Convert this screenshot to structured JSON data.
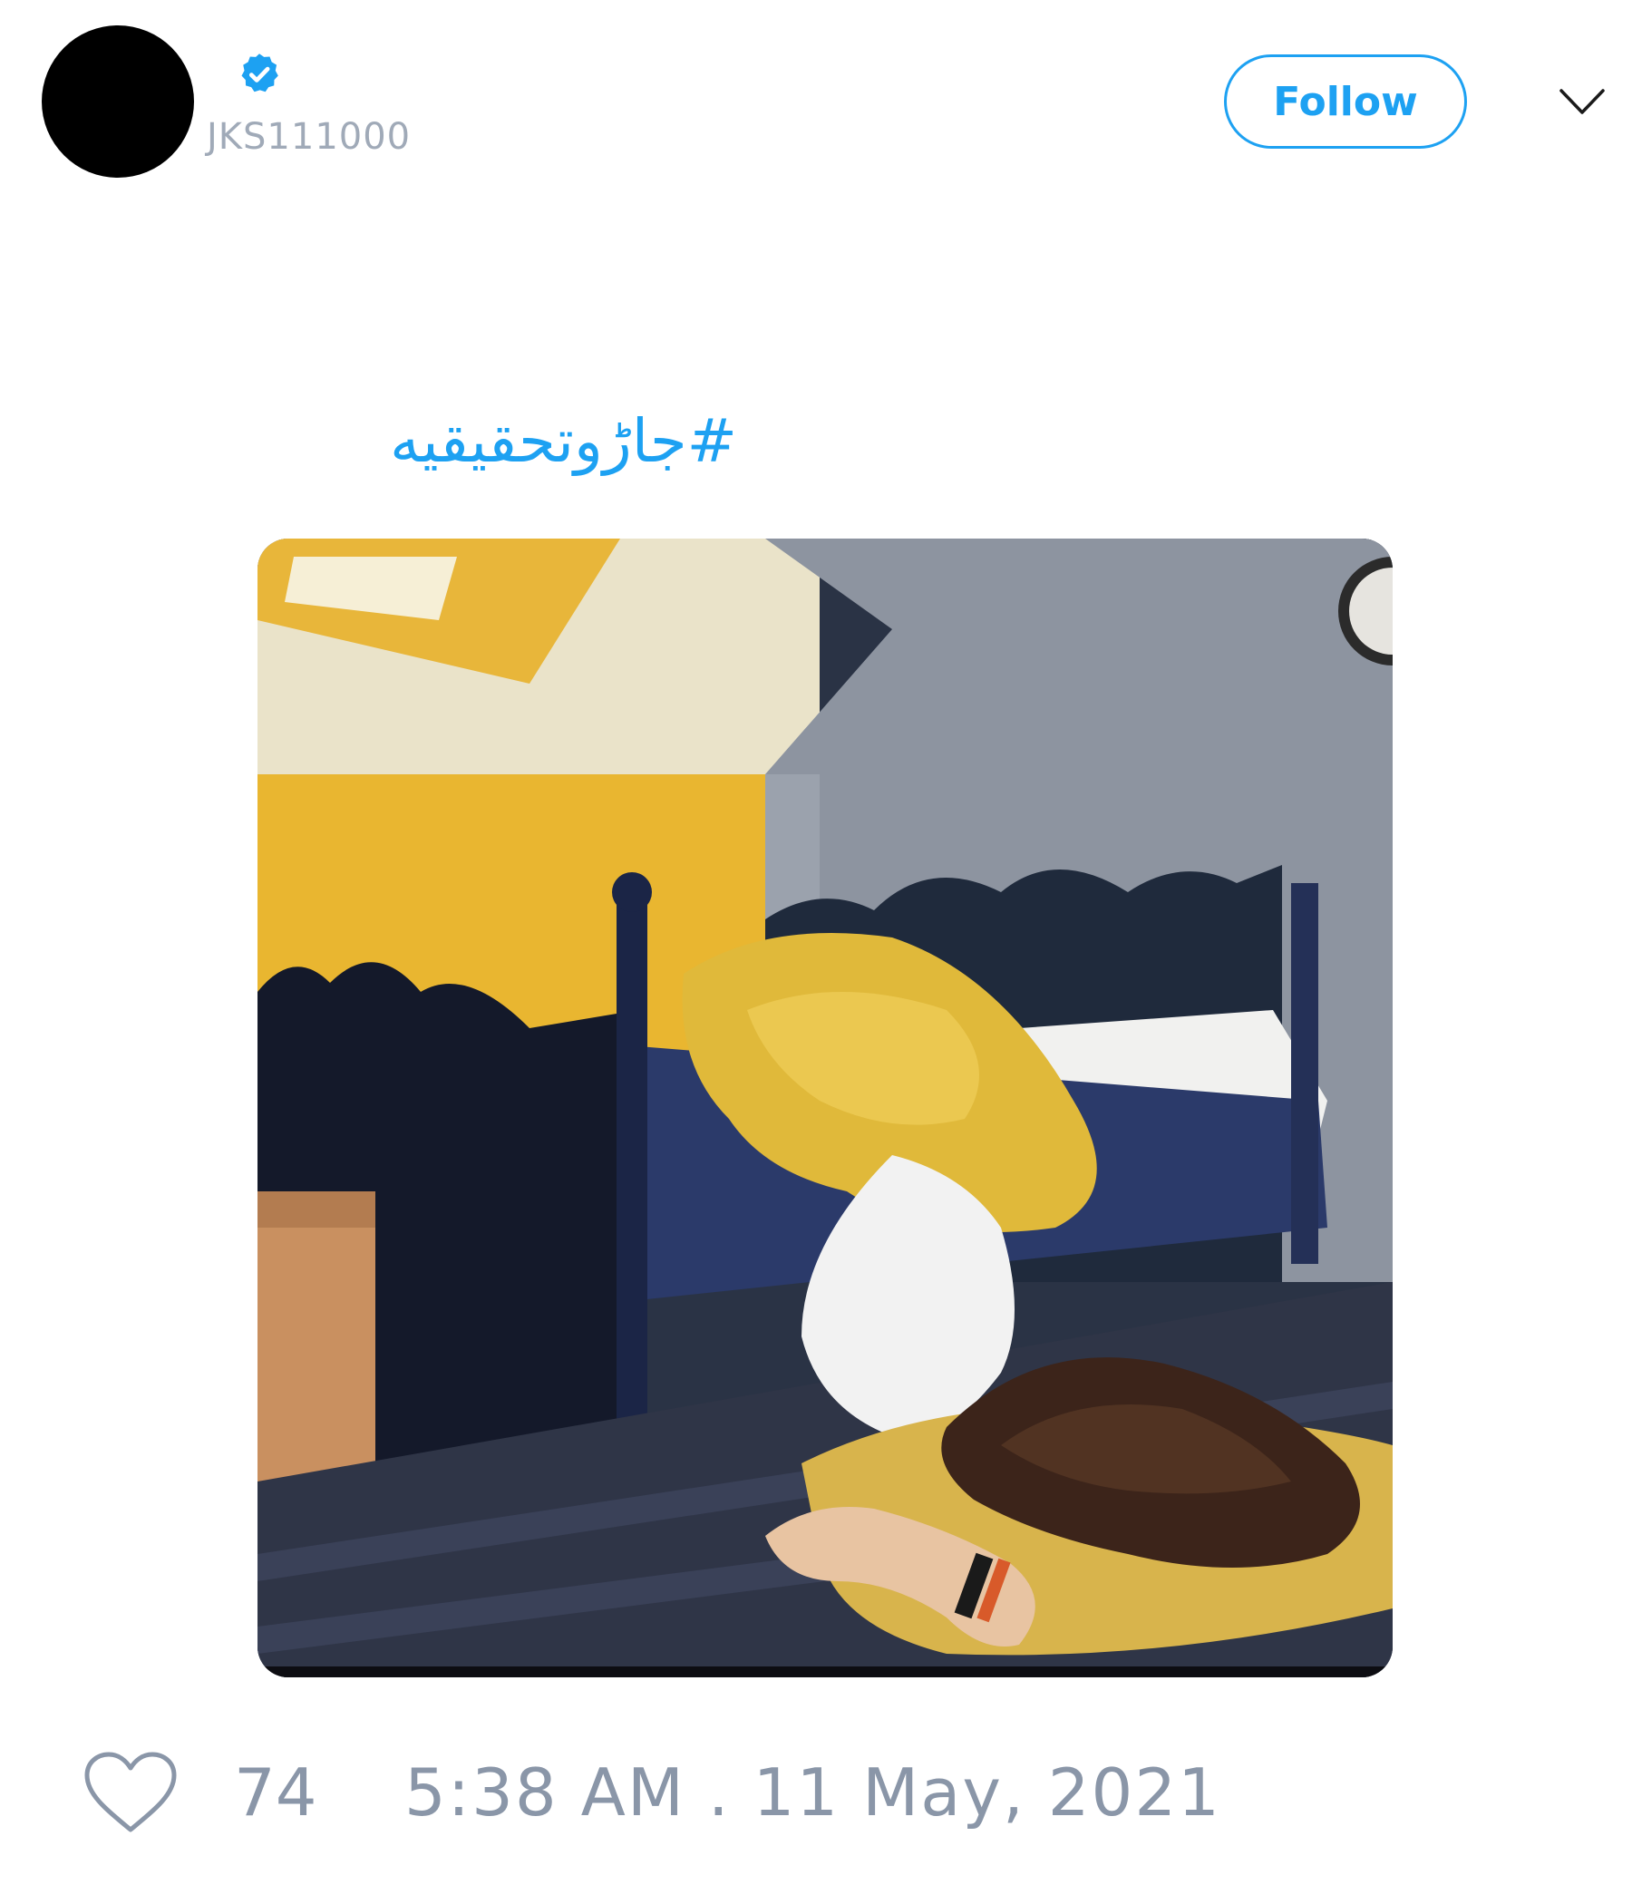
{
  "tweet": {
    "author": {
      "handle": "JKS111000",
      "verified": true,
      "avatar_color": "#000000"
    },
    "follow_label": "Follow",
    "menu_icon": "chevron-down-icon",
    "text": "#جاڑوتحقیقیه",
    "media": {
      "kind": "photo",
      "icon": "image-icon"
    },
    "like_icon": "heart-icon",
    "like_count": "74",
    "timestamp": "5:38 AM . 11 May, 2021"
  },
  "colors": {
    "accent": "#1da1f2",
    "muted_text": "#8a96a8",
    "handle_text": "#a0aab8"
  }
}
